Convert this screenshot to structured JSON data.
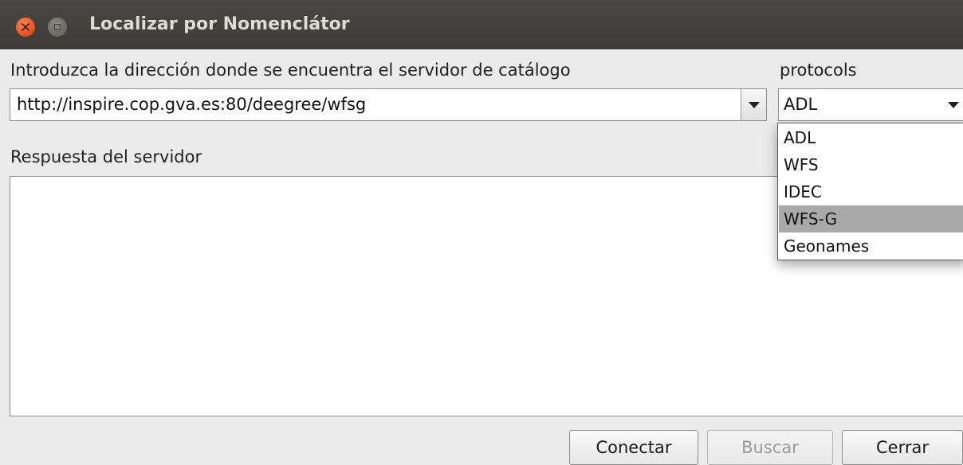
{
  "window": {
    "title": "Localizar por Nomenclátor"
  },
  "server": {
    "label": "Introduzca la dirección donde se encuentra el servidor de catálogo",
    "url_value": "http://inspire.cop.gva.es:80/deegree/wfsg"
  },
  "protocols": {
    "label": "protocols",
    "selected": "ADL",
    "options": [
      "ADL",
      "WFS",
      "IDEC",
      "WFS-G",
      "Geonames"
    ],
    "highlighted": "WFS-G"
  },
  "response": {
    "label": "Respuesta del servidor",
    "text": ""
  },
  "buttons": {
    "connect": "Conectar",
    "search": "Buscar",
    "close": "Cerrar"
  },
  "colors": {
    "titlebar": "#3c3b37",
    "close_button": "#e95420",
    "highlight": "#a9a9a9"
  }
}
